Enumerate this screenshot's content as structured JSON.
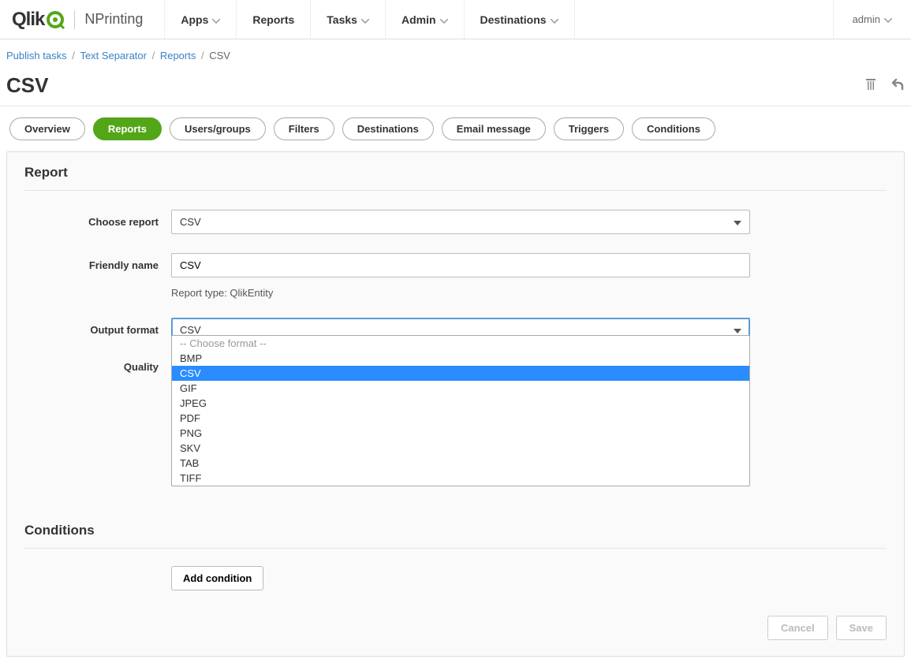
{
  "logo": {
    "brand": "Qlik",
    "product": "NPrinting"
  },
  "nav": {
    "items": [
      {
        "label": "Apps",
        "hasCaret": true
      },
      {
        "label": "Reports",
        "hasCaret": false
      },
      {
        "label": "Tasks",
        "hasCaret": true
      },
      {
        "label": "Admin",
        "hasCaret": true
      },
      {
        "label": "Destinations",
        "hasCaret": true
      }
    ],
    "user": "admin"
  },
  "breadcrumb": {
    "items": [
      "Publish tasks",
      "Text Separator",
      "Reports"
    ],
    "current": "CSV"
  },
  "page": {
    "title": "CSV"
  },
  "tabs": {
    "items": [
      "Overview",
      "Reports",
      "Users/groups",
      "Filters",
      "Destinations",
      "Email message",
      "Triggers",
      "Conditions"
    ],
    "activeIndex": 1
  },
  "form": {
    "section_report": "Report",
    "choose_report_label": "Choose report",
    "choose_report_value": "CSV",
    "friendly_name_label": "Friendly name",
    "friendly_name_value": "CSV",
    "report_type_text": "Report type: QlikEntity",
    "output_format_label": "Output format",
    "output_format_value": "CSV",
    "quality_label": "Quality",
    "section_conditions": "Conditions",
    "add_condition_label": "Add condition"
  },
  "dropdown": {
    "placeholder": "-- Choose format --",
    "options": [
      "BMP",
      "CSV",
      "GIF",
      "JPEG",
      "PDF",
      "PNG",
      "SKV",
      "TAB",
      "TIFF"
    ],
    "selected": "CSV"
  },
  "actions": {
    "cancel": "Cancel",
    "save": "Save"
  }
}
